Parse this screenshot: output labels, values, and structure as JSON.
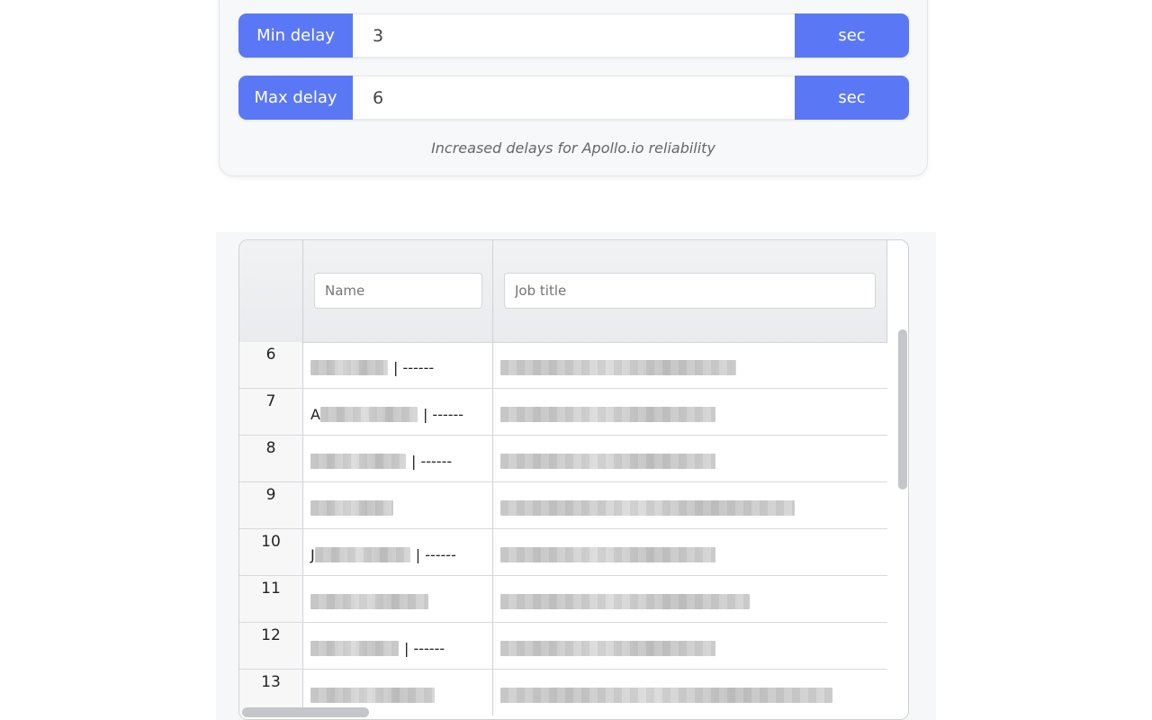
{
  "settings": {
    "min_delay": {
      "label": "Min delay",
      "value": "3",
      "unit": "sec"
    },
    "max_delay": {
      "label": "Max delay",
      "value": "6",
      "unit": "sec"
    },
    "note": "Increased delays for Apollo.io reliability"
  },
  "table": {
    "filters": {
      "name_placeholder": "Name",
      "job_placeholder": "Job title"
    },
    "rows": [
      {
        "index": "6",
        "name_prefix": "",
        "name_suffix": "| ------"
      },
      {
        "index": "7",
        "name_prefix": "A",
        "name_suffix": "| ------"
      },
      {
        "index": "8",
        "name_prefix": "",
        "name_suffix": "| ------"
      },
      {
        "index": "9",
        "name_prefix": "",
        "name_suffix": ""
      },
      {
        "index": "10",
        "name_prefix": "J",
        "name_suffix": "| ------"
      },
      {
        "index": "11",
        "name_prefix": "",
        "name_suffix": ""
      },
      {
        "index": "12",
        "name_prefix": "",
        "name_suffix": "| ------"
      },
      {
        "index": "13",
        "name_prefix": "",
        "name_suffix": ""
      }
    ]
  },
  "colors": {
    "accent": "#5a78f5",
    "card_bg": "#f7f8fa",
    "grid_border": "#cfd2d6"
  }
}
